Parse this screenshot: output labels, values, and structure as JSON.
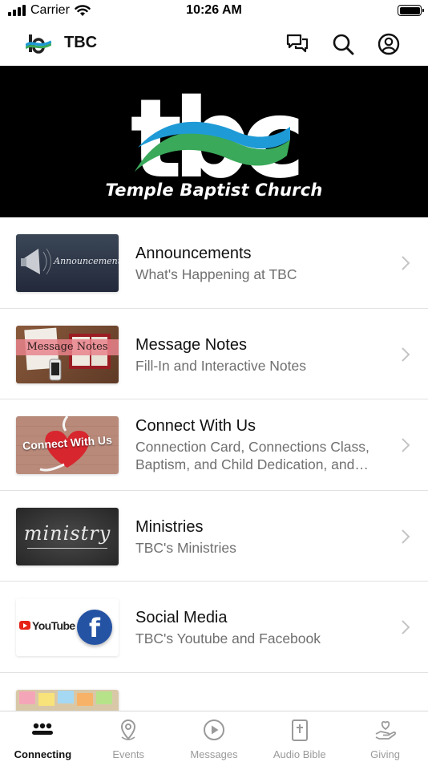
{
  "status_bar": {
    "carrier": "Carrier",
    "time": "10:26 AM"
  },
  "nav": {
    "title": "TBC"
  },
  "banner": {
    "logo_letters": "tbc",
    "caption": "Temple Baptist Church"
  },
  "items": [
    {
      "title": "Announcements",
      "subtitle": "What's Happening at TBC",
      "thumb_text": "Announcements"
    },
    {
      "title": "Message Notes",
      "subtitle": "Fill-In and Interactive Notes",
      "thumb_text": "Message Notes"
    },
    {
      "title": "Connect With Us",
      "subtitle": "Connection Card, Connections Class, Baptism, and Child Dedication, and…",
      "thumb_text": "Connect With Us"
    },
    {
      "title": "Ministries",
      "subtitle": "TBC's Ministries",
      "thumb_text": "ministry"
    },
    {
      "title": "Social Media",
      "subtitle": "TBC's Youtube and Facebook",
      "thumb_text": "YouTube",
      "thumb_text_2": "f"
    }
  ],
  "tabs": [
    {
      "label": "Connecting",
      "icon": "people-icon",
      "active": true
    },
    {
      "label": "Events",
      "icon": "location-pin-icon"
    },
    {
      "label": "Messages",
      "icon": "play-circle-icon"
    },
    {
      "label": "Audio Bible",
      "icon": "bible-icon"
    },
    {
      "label": "Giving",
      "icon": "giving-hand-icon"
    }
  ],
  "colors": {
    "accent_blue": "#1e9ad6",
    "accent_green": "#3aa95a",
    "banner_bg": "#000000",
    "youtube_red": "#e62117",
    "facebook_blue": "#2553a4"
  }
}
